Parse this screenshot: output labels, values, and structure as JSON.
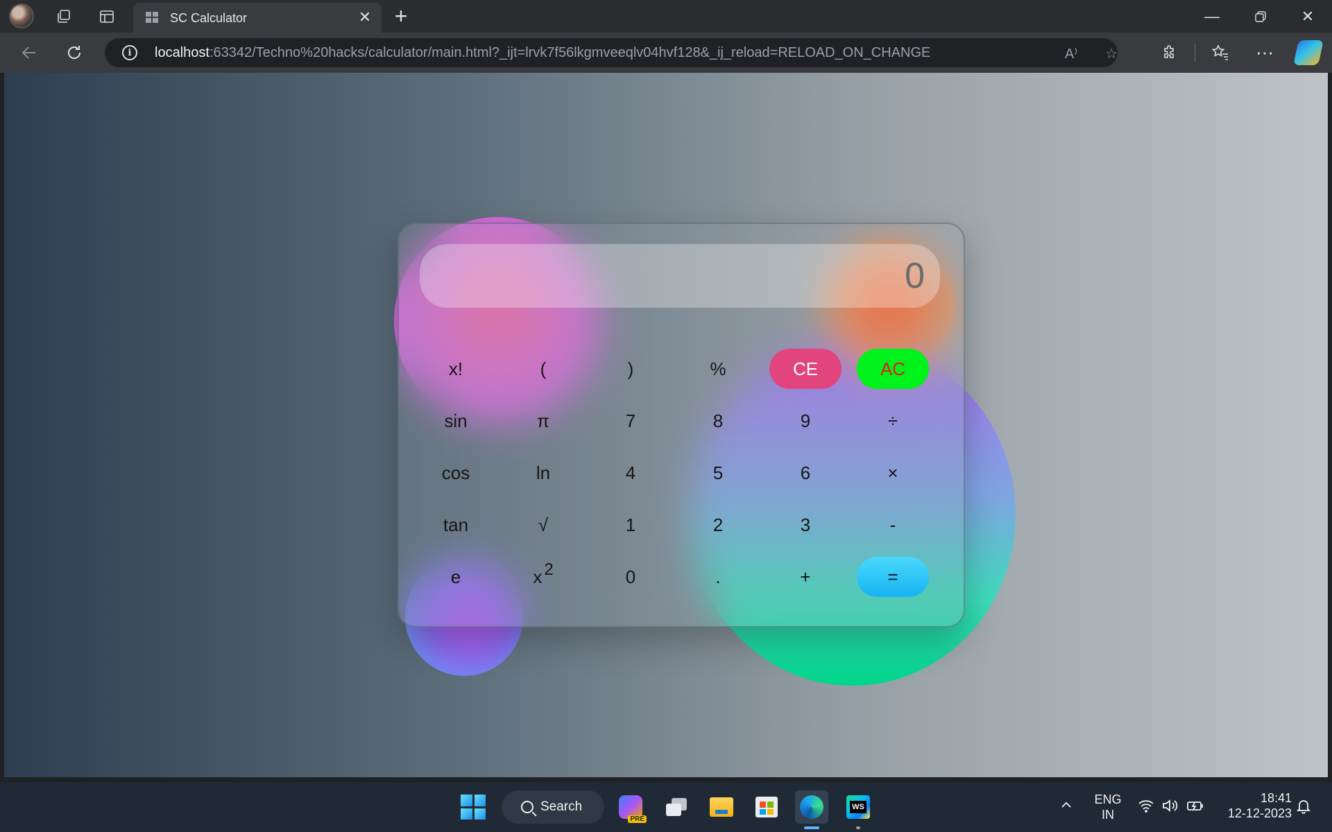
{
  "browser": {
    "tab_title": "SC Calculator",
    "url_host": "localhost",
    "url_rest": ":63342/Techno%20hacks/calculator/main.html?_ijt=lrvk7f56lkgmveeqlv04hvf128&_ij_reload=RELOAD_ON_CHANGE",
    "read_aloud_label": "A⁾"
  },
  "calculator": {
    "display_value": "0",
    "keys": {
      "fact": "x!",
      "lparen": "(",
      "rparen": ")",
      "percent": "%",
      "ce": "CE",
      "ac": "AC",
      "sin": "sin",
      "pi": "π",
      "seven": "7",
      "eight": "8",
      "nine": "9",
      "divide": "÷",
      "cos": "cos",
      "ln": "ln",
      "four": "4",
      "five": "5",
      "six": "6",
      "multiply": "×",
      "tan": "tan",
      "sqrt": "√",
      "one": "1",
      "two": "2",
      "three": "3",
      "minus": "-",
      "e": "e",
      "square_base": "x",
      "square_exp": "2",
      "zero": "0",
      "dot": ".",
      "plus": "+",
      "equals": "="
    },
    "colors": {
      "ce": "#e2447e",
      "ac": "#00f21b",
      "ac_text": "#e01c1c",
      "equals": "#1fbaf3"
    }
  },
  "taskbar": {
    "search_label": "Search",
    "lang_line1": "ENG",
    "lang_line2": "IN",
    "time": "18:41",
    "date": "12-12-2023",
    "copilot_badge": "PRE",
    "webstorm_badge": "WS"
  }
}
